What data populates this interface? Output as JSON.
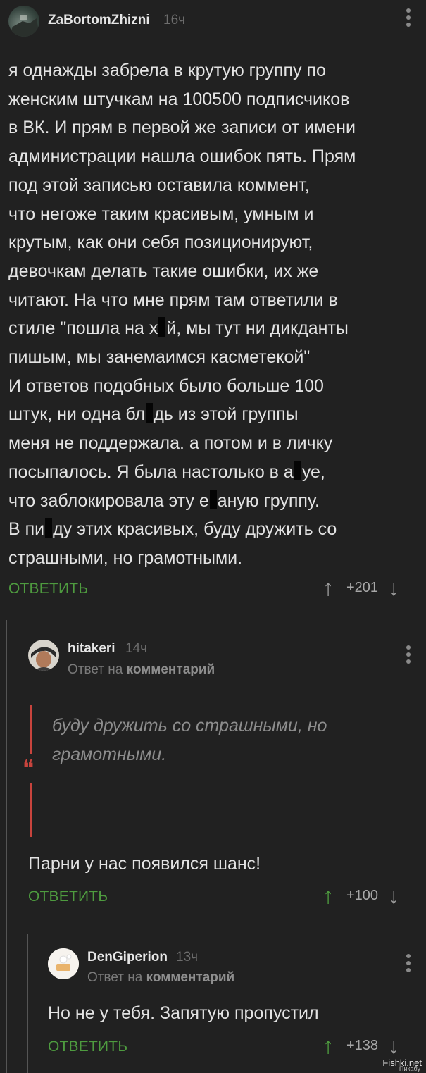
{
  "comments": [
    {
      "author": "ZaBortomZhizni",
      "time": "16ч",
      "text_lines": [
        [
          "я однажды забрела в крутую группу по"
        ],
        [
          "женским штучкам на 100500 подписчиков"
        ],
        [
          "в ВК. И прям в первой же записи от имени"
        ],
        [
          "администрации нашла ошибок пять. Прям"
        ],
        [
          "под этой записью оставила коммент,"
        ],
        [
          "что негоже таким красивым, умным и"
        ],
        [
          "крутым, как они себя позиционируют,"
        ],
        [
          "девочкам делать такие ошибки, их же"
        ],
        [
          "читают. На что мне прям там ответили в"
        ],
        [
          "стиле \"пошла на х",
          "й, мы тут ни дикданты"
        ],
        [
          "пишым, мы занемаимся касметекой\""
        ],
        [
          "И ответов подобных было больше 100"
        ],
        [
          "штук, ни одна бл",
          "дь из этой группы"
        ],
        [
          "меня не поддержала. а потом и в личку"
        ],
        [
          "посыпалось. Я была настолько в а",
          "уе,"
        ],
        [
          "что заблокировала эту е",
          "аную группу."
        ],
        [
          "В пи",
          "ду этих красивых, буду дружить со"
        ],
        [
          "страшными, но грамотными."
        ]
      ],
      "reply_label": "ОТВЕТИТЬ",
      "rating": "+201"
    },
    {
      "author": "hitakeri",
      "time": "14ч",
      "reply_prefix": "Ответ на",
      "reply_target": "комментарий",
      "quote_mark": "❝",
      "quote_lines": [
        "буду дружить со страшными, но",
        "грамотными."
      ],
      "text": "Парни у нас появился шанс!",
      "reply_label": "ОТВЕТИТЬ",
      "rating": "+100"
    },
    {
      "author": "DenGiperion",
      "time": "13ч",
      "reply_prefix": "Ответ на",
      "reply_target": "комментарий",
      "text": "Но не у тебя. Запятую пропустил",
      "reply_label": "ОТВЕТИТЬ",
      "rating": "+138"
    }
  ],
  "watermark": "Fishki.net",
  "watermark_small": "Пикабу"
}
